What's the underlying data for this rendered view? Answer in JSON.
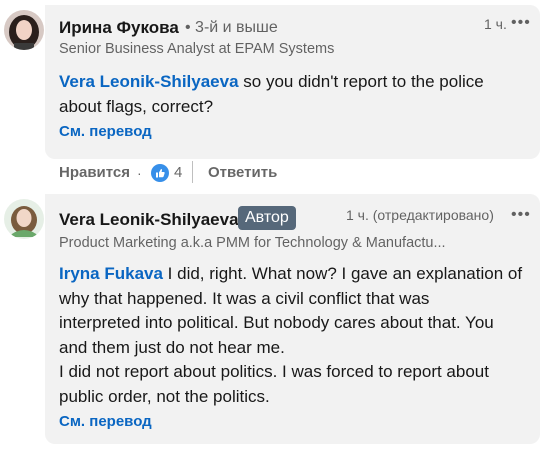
{
  "comments": [
    {
      "author": "Ирина Фукова",
      "degree": "• 3-й и выше",
      "headline": "Senior Business Analyst at EPAM Systems",
      "time": "1 ч.",
      "more": "•••",
      "mention": "Vera Leonik-Shilyaeva",
      "text_line1_rest": " so you didn't report to the police",
      "text_line2": "about flags, correct?",
      "translate": "См. перевод",
      "avatar_icon": "user-avatar-icon",
      "actions": {
        "like": "Нравится",
        "dot": "·",
        "reaction_icon": "like-reaction-icon",
        "reaction_count": "4",
        "reply": "Ответить"
      }
    },
    {
      "author": "Vera Leonik-Shilyaeva",
      "badge": "Автор",
      "headline": "Product Marketing a.k.a PMM for Technology & Manufactu...",
      "time": "1 ч. (отредактировано)",
      "more": "•••",
      "mention": "Iryna Fukava",
      "text_line1_rest": " I did, right. What now? I gave an explanation of",
      "text_lines": [
        "why that happened. It was a civil conflict that was",
        "interpreted into political. But nobody cares about that. You",
        "and them just do not hear me.",
        "I did not report about politics. I was forced to report about",
        "public order, not the politics."
      ],
      "translate": "См. перевод",
      "avatar_icon": "user-avatar-icon"
    }
  ],
  "colors": {
    "link": "#0a66c2",
    "bubble": "#f2f2f2",
    "badge": "#56687a"
  }
}
